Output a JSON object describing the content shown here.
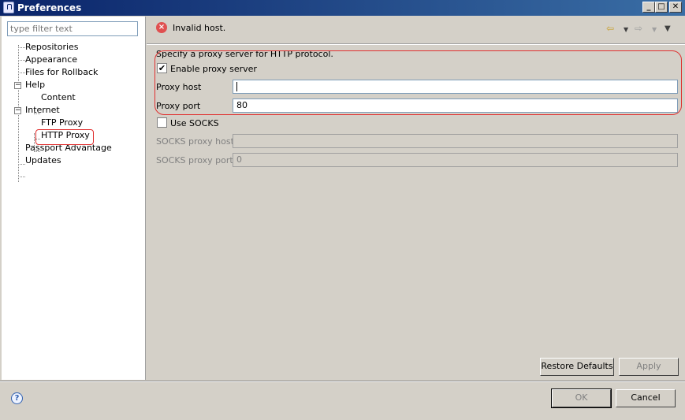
{
  "window": {
    "title": "Preferences",
    "buttons": {
      "minimize": "_",
      "maximize": "□",
      "close": "✕"
    }
  },
  "filter": {
    "placeholder": "type filter text"
  },
  "tree": {
    "items": [
      {
        "label": "Repositories"
      },
      {
        "label": "Appearance"
      },
      {
        "label": "Files for Rollback"
      },
      {
        "label": "Help",
        "expanded": true,
        "toggle": "−"
      },
      {
        "label": "Content"
      },
      {
        "label": "Internet",
        "expanded": true,
        "toggle": "−"
      },
      {
        "label": "FTP Proxy"
      },
      {
        "label": "HTTP Proxy",
        "selected": true
      },
      {
        "label": "Passport Advantage"
      },
      {
        "label": "Updates"
      }
    ]
  },
  "message": {
    "icon": "error-icon",
    "text": "Invalid host.",
    "glyph": "×"
  },
  "nav": {
    "back": "⇦",
    "back_dropdown": "▼",
    "forward": "⇨",
    "forward_dropdown": "▼",
    "menu": "▼"
  },
  "form": {
    "description": "Specify a proxy server for HTTP protocol.",
    "enable_proxy": {
      "label": "Enable proxy server",
      "checked": true,
      "mark": "✔"
    },
    "proxy_host": {
      "label": "Proxy host",
      "value": ""
    },
    "proxy_port": {
      "label": "Proxy port",
      "value": "80"
    },
    "use_socks": {
      "label": "Use SOCKS",
      "checked": false
    },
    "socks_host": {
      "label": "SOCKS proxy host",
      "value": ""
    },
    "socks_port": {
      "label": "SOCKS proxy port",
      "value": "0"
    }
  },
  "buttons": {
    "restore_defaults": "Restore Defaults",
    "apply": "Apply",
    "ok": "OK",
    "cancel": "Cancel"
  },
  "help": {
    "glyph": "?"
  },
  "colors": {
    "error": "#e05050",
    "annotation": "#e03030",
    "title_bar": "#0a246a"
  }
}
